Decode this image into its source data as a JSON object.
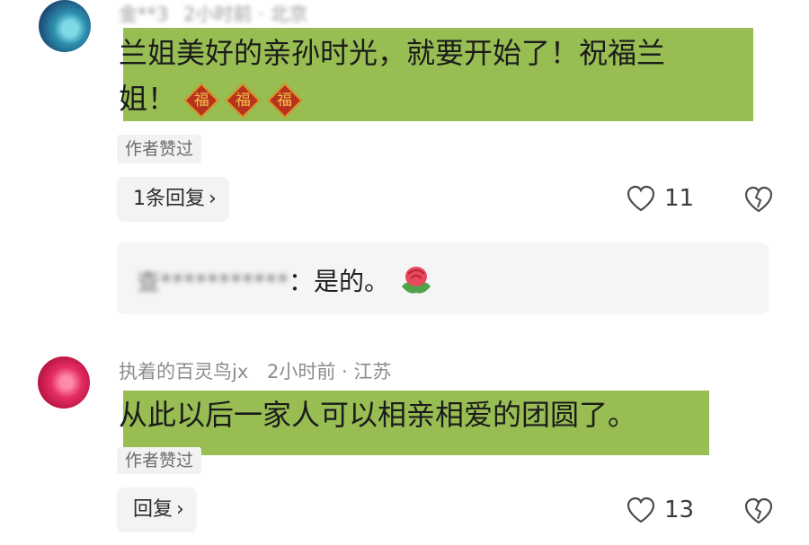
{
  "comments": [
    {
      "username": "金**3",
      "time": "2小时前",
      "location": "北京",
      "text_line1": "兰姐美好的亲孙时光，就要开始了！祝福兰",
      "text_line2": "姐！",
      "emoji_char": "福",
      "tag": "作者赞过",
      "reply_label": "1条回复",
      "likes": "11",
      "sub_reply": {
        "author_blurred": "查***********",
        "text": "：是的。"
      }
    },
    {
      "username": "执着的百灵鸟jx",
      "time": "2小时前",
      "location": "江苏",
      "text": "从此以后一家人可以相亲相爱的团圆了。",
      "tag": "作者赞过",
      "reply_label": "回复",
      "likes": "13"
    }
  ],
  "meta_separator": "·",
  "chevron": "›"
}
